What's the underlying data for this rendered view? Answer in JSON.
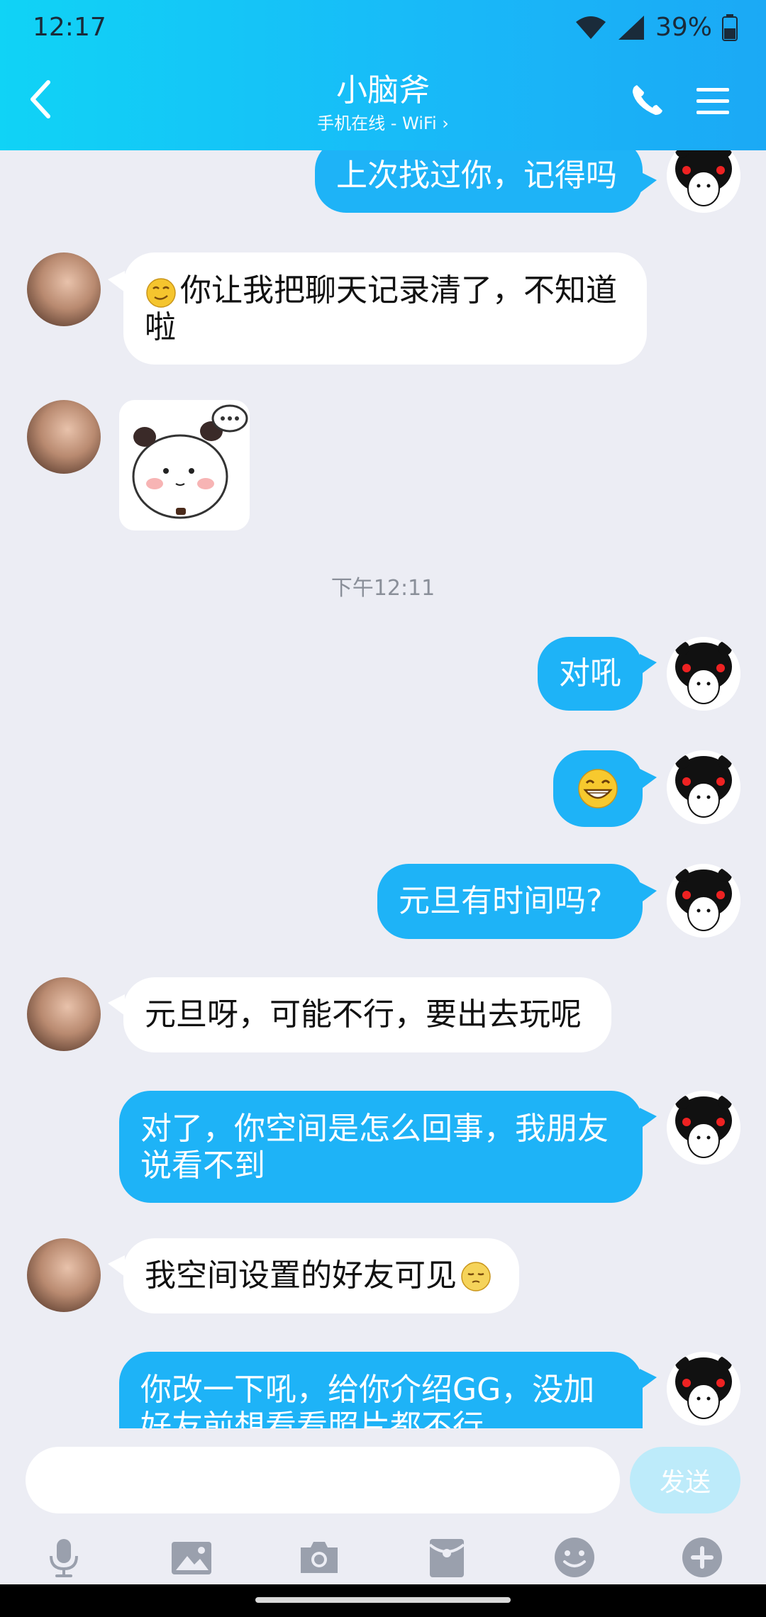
{
  "status_bar": {
    "time": "12:17",
    "battery": "39%"
  },
  "header": {
    "title": "小脑斧",
    "subtitle": "手机在线 - WiFi",
    "icons": [
      "back-arrow-icon",
      "phone-icon",
      "menu-icon"
    ]
  },
  "messages": [
    {
      "from": "me",
      "text": "上次找过你，记得吗"
    },
    {
      "from": "them",
      "text": "你让我把聊天记录清了，不知道啦",
      "line1": "你让我把聊天记录清了，不知道",
      "line2": "啦",
      "emoji": "smug-emoji"
    },
    {
      "from": "them",
      "type": "sticker",
      "sticker": "panda-thinking-sticker"
    },
    {
      "type": "timestamp",
      "text": "下午12:11"
    },
    {
      "from": "me",
      "text": "对吼"
    },
    {
      "from": "me",
      "type": "emoji",
      "emoji": "grin-emoji"
    },
    {
      "from": "me",
      "text": "元旦有时间吗?"
    },
    {
      "from": "them",
      "text": "元旦呀，可能不行，要出去玩呢"
    },
    {
      "from": "me",
      "line1": "对了，你空间是怎么回事，我朋友",
      "line2": "说看不到"
    },
    {
      "from": "them",
      "text": "我空间设置的好友可见",
      "emoji": "shy-emoji"
    },
    {
      "from": "me",
      "line1": "你改一下吼，给你介绍GG，没加",
      "line2": "好友前想看看照片都不行"
    }
  ],
  "input": {
    "placeholder": "",
    "send_label": "发送"
  },
  "toolbar": [
    "microphone-icon",
    "image-icon",
    "camera-icon",
    "red-packet-icon",
    "emoji-icon",
    "plus-icon"
  ],
  "colors": {
    "accent": "#1EB3F7",
    "header_start": "#10D3F6",
    "background": "#ECEDF4",
    "send_disabled": "#BDEBFA"
  }
}
